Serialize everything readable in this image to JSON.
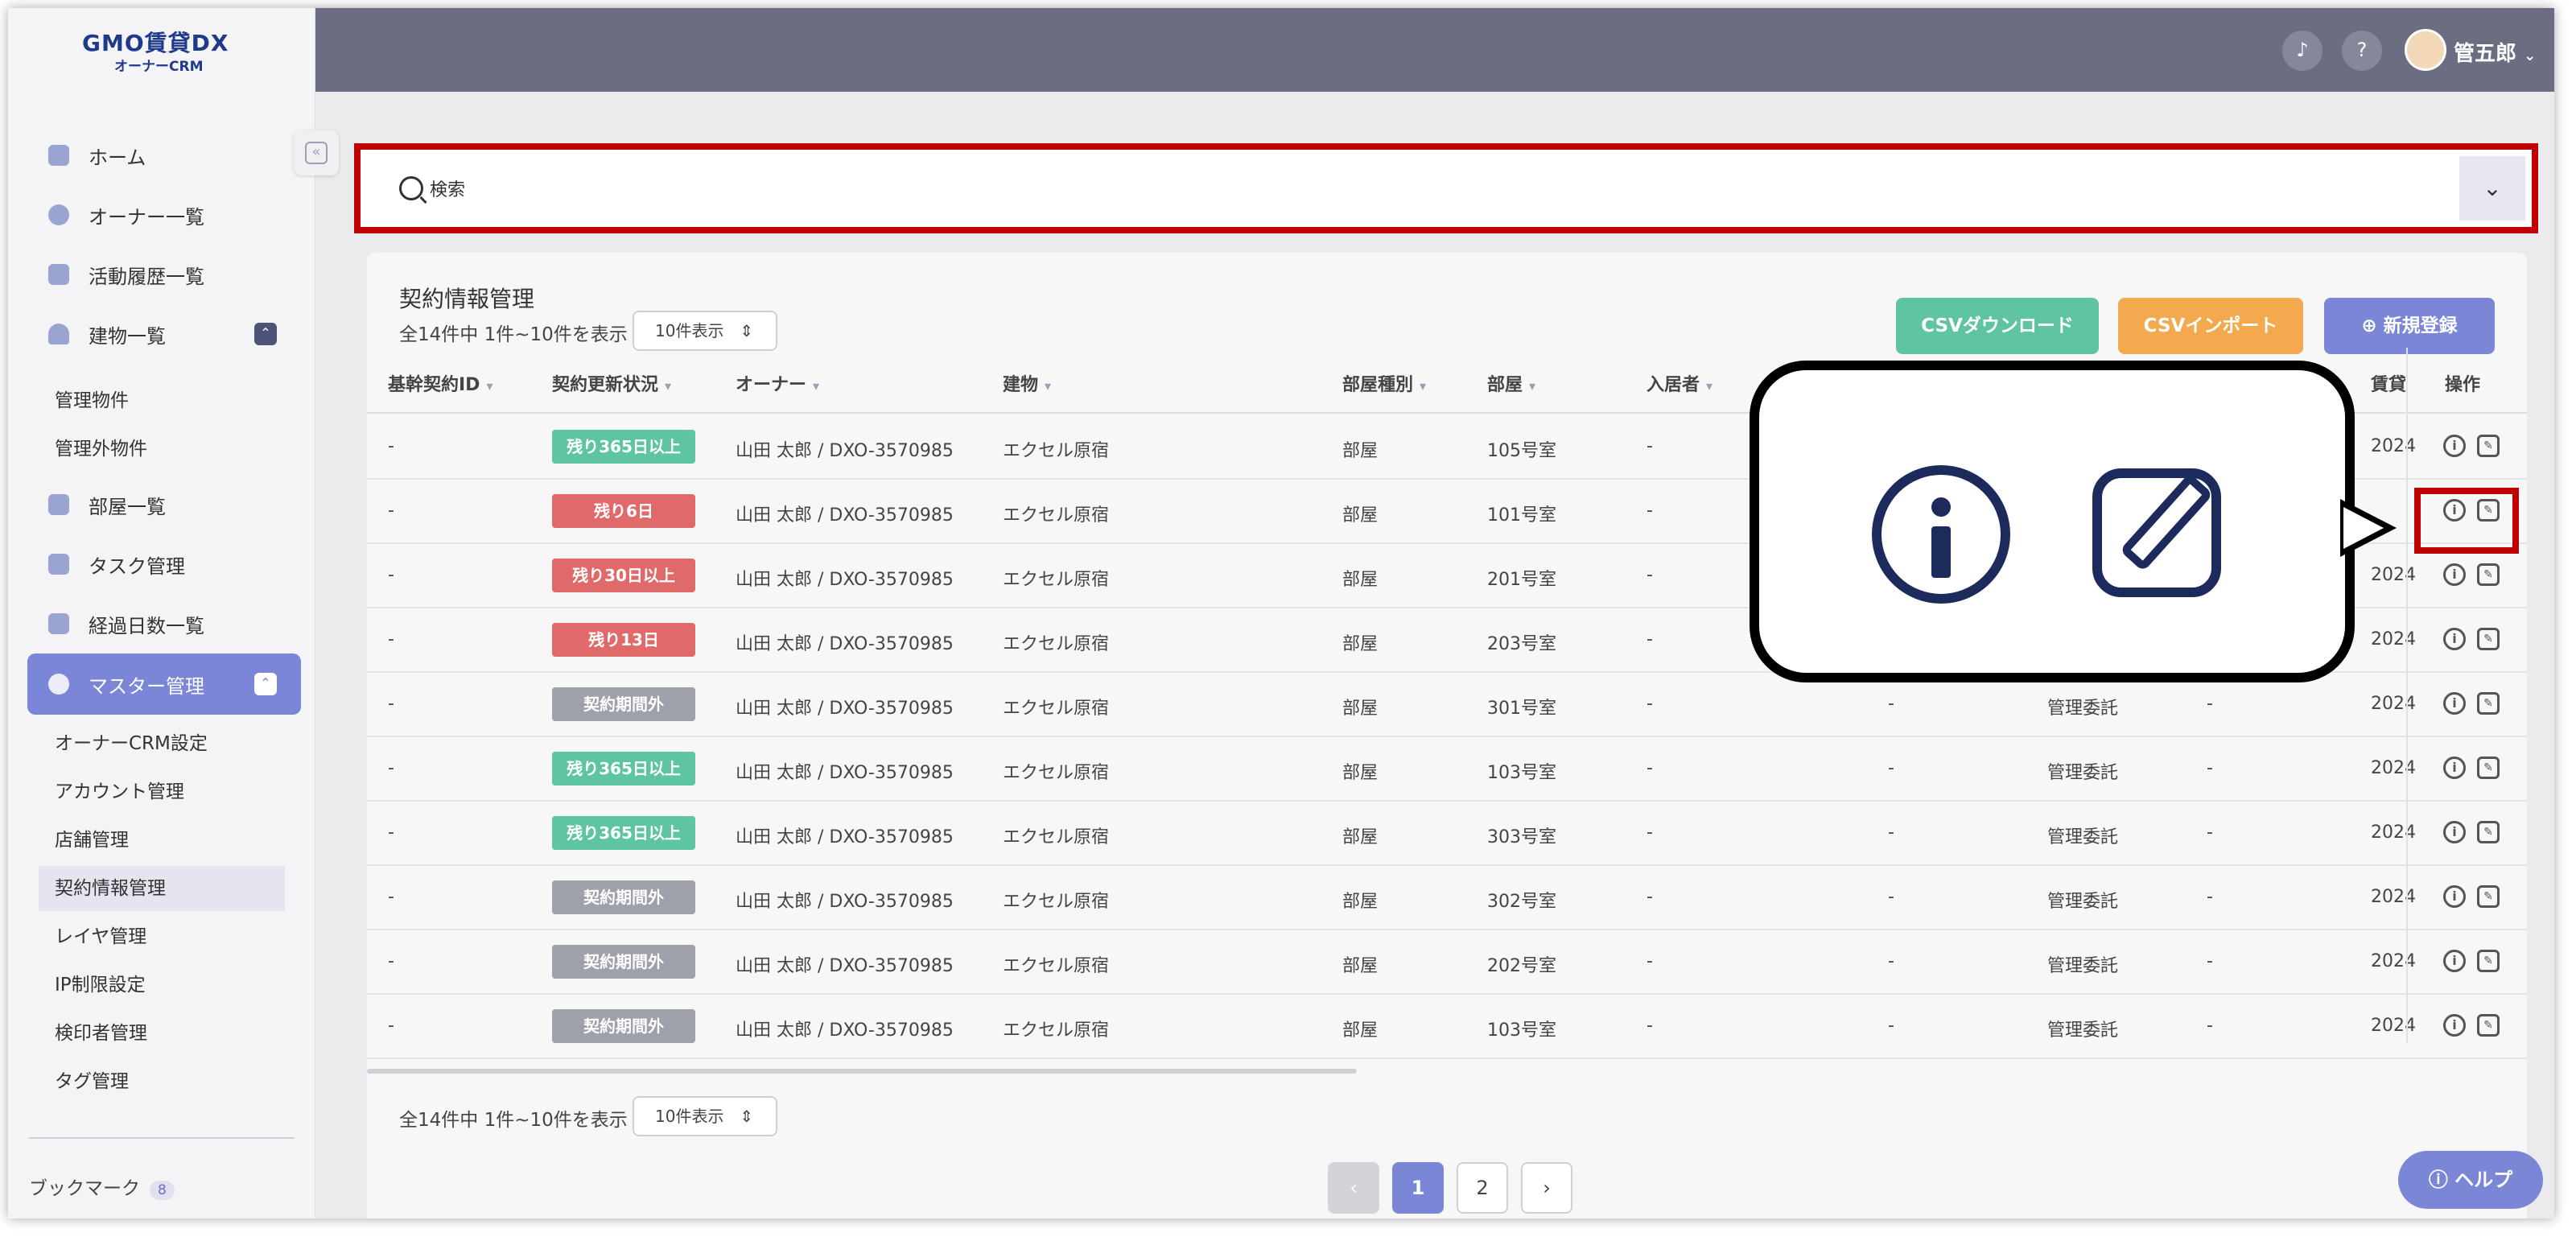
{
  "brand": {
    "logo": "GMO賃貸DX",
    "sub": "オーナーCRM"
  },
  "sidebar": {
    "items": [
      {
        "label": "ホーム"
      },
      {
        "label": "オーナー一覧"
      },
      {
        "label": "活動履歴一覧"
      },
      {
        "label": "建物一覧"
      },
      {
        "label": "部屋一覧"
      },
      {
        "label": "タスク管理"
      },
      {
        "label": "経過日数一覧"
      },
      {
        "label": "マスター管理"
      }
    ],
    "building_sub": [
      "管理物件",
      "管理外物件"
    ],
    "master_sub": [
      "オーナーCRM設定",
      "アカウント管理",
      "店舗管理",
      "契約情報管理",
      "レイヤ管理",
      "IP制限設定",
      "検印者管理",
      "タグ管理"
    ],
    "bookmark_label": "ブックマーク",
    "bookmark_count": "8"
  },
  "topbar": {
    "username": "管五郎"
  },
  "search": {
    "placeholder": "検索"
  },
  "card": {
    "title": "契約情報管理",
    "count_text": "全14件中 1件~10件を表示",
    "page_size": "10件表示",
    "csv_download": "CSVダウンロード",
    "csv_import": "CSVインポート",
    "new_register": "新規登録"
  },
  "table": {
    "headers": [
      "基幹契約ID",
      "契約更新状況",
      "オーナー",
      "建物",
      "部屋種別",
      "部屋",
      "入居者",
      "賃貸",
      "操作"
    ],
    "rows": [
      {
        "id": "-",
        "status": "残り365日以上",
        "tone": "green",
        "owner": "山田 太郎 / DXO-3570985",
        "building": "エクセル原宿",
        "type": "部屋",
        "room": "105号室",
        "tenant": "-",
        "extra": "",
        "mgmt": "",
        "dash2": "",
        "date": "2024"
      },
      {
        "id": "-",
        "status": "残り6日",
        "tone": "red",
        "owner": "山田 太郎 / DXO-3570985",
        "building": "エクセル原宿",
        "type": "部屋",
        "room": "101号室",
        "tenant": "-",
        "extra": "",
        "mgmt": "",
        "dash2": "",
        "date": ""
      },
      {
        "id": "-",
        "status": "残り30日以上",
        "tone": "red",
        "owner": "山田 太郎 / DXO-3570985",
        "building": "エクセル原宿",
        "type": "部屋",
        "room": "201号室",
        "tenant": "-",
        "extra": "",
        "mgmt": "",
        "dash2": "",
        "date": "2024"
      },
      {
        "id": "-",
        "status": "残り13日",
        "tone": "red",
        "owner": "山田 太郎 / DXO-3570985",
        "building": "エクセル原宿",
        "type": "部屋",
        "room": "203号室",
        "tenant": "-",
        "extra": "",
        "mgmt": "",
        "dash2": "",
        "date": "2024"
      },
      {
        "id": "-",
        "status": "契約期間外",
        "tone": "gray",
        "owner": "山田 太郎 / DXO-3570985",
        "building": "エクセル原宿",
        "type": "部屋",
        "room": "301号室",
        "tenant": "-",
        "extra": "-",
        "mgmt": "管理委託",
        "dash2": "-",
        "date": "2024"
      },
      {
        "id": "-",
        "status": "残り365日以上",
        "tone": "green",
        "owner": "山田 太郎 / DXO-3570985",
        "building": "エクセル原宿",
        "type": "部屋",
        "room": "103号室",
        "tenant": "-",
        "extra": "-",
        "mgmt": "管理委託",
        "dash2": "-",
        "date": "2024"
      },
      {
        "id": "-",
        "status": "残り365日以上",
        "tone": "green",
        "owner": "山田 太郎 / DXO-3570985",
        "building": "エクセル原宿",
        "type": "部屋",
        "room": "303号室",
        "tenant": "-",
        "extra": "-",
        "mgmt": "管理委託",
        "dash2": "-",
        "date": "2024"
      },
      {
        "id": "-",
        "status": "契約期間外",
        "tone": "gray",
        "owner": "山田 太郎 / DXO-3570985",
        "building": "エクセル原宿",
        "type": "部屋",
        "room": "302号室",
        "tenant": "-",
        "extra": "-",
        "mgmt": "管理委託",
        "dash2": "-",
        "date": "2024"
      },
      {
        "id": "-",
        "status": "契約期間外",
        "tone": "gray",
        "owner": "山田 太郎 / DXO-3570985",
        "building": "エクセル原宿",
        "type": "部屋",
        "room": "202号室",
        "tenant": "-",
        "extra": "-",
        "mgmt": "管理委託",
        "dash2": "-",
        "date": "2024"
      },
      {
        "id": "-",
        "status": "契約期間外",
        "tone": "gray",
        "owner": "山田 太郎 / DXO-3570985",
        "building": "エクセル原宿",
        "type": "部屋",
        "room": "103号室",
        "tenant": "-",
        "extra": "-",
        "mgmt": "管理委託",
        "dash2": "-",
        "date": "2024"
      }
    ]
  },
  "footer": {
    "count_text": "全14件中 1件~10件を表示",
    "page_size": "10件表示",
    "pages": [
      "1",
      "2"
    ]
  },
  "help": {
    "label": "ヘルプ"
  },
  "colors": {
    "accent": "#7b87d6",
    "green": "#5fc5a0",
    "red": "#e06a6a",
    "gray": "#9ea0aa",
    "orange": "#f3a94e",
    "highlight": "#c00000"
  }
}
